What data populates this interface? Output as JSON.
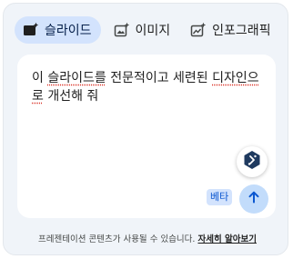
{
  "tabs": [
    {
      "label": "슬라이드",
      "icon": "slides-sparkle-icon",
      "active": true
    },
    {
      "label": "이미지",
      "icon": "image-sparkle-icon",
      "active": false
    },
    {
      "label": "인포그래픽",
      "icon": "chart-sparkle-icon",
      "active": false
    }
  ],
  "prompt": {
    "part1": "이 ",
    "part2": "슬라이드를",
    "part3": " 전문적이고 세련된 ",
    "part4": "디자인으로",
    "part5": " 개선해 줘"
  },
  "beta_label": "베타",
  "footer": {
    "text": "프레젠테이션 콘텐츠가 사용될 수 있습니다. ",
    "link": "자세히 알아보기"
  },
  "colors": {
    "accent": "#0b57d0",
    "active_tab_bg": "#d3e3fd",
    "send_bg": "#c2dcfb",
    "gem_icon": "#1f3a5f"
  }
}
